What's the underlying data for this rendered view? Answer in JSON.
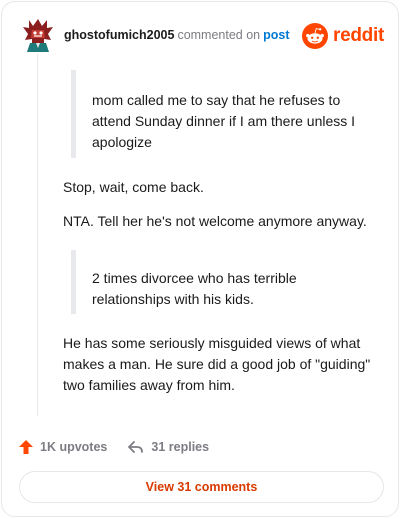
{
  "header": {
    "username": "ghostofumich2005",
    "action_text": "commented on",
    "post_link": "post",
    "brand_name": "reddit"
  },
  "comment": {
    "quote1": "mom called me to say that he refuses to attend Sunday dinner if I am there unless I apologize",
    "para1": "Stop, wait, come back.",
    "para2": "NTA. Tell her he's not welcome anymore anyway.",
    "quote2": "2 times divorcee who has terrible relationships with his kids.",
    "para3": "He has some seriously misguided views of what makes a man. He sure did a good job of \"guiding\" two families away from him."
  },
  "actions": {
    "upvotes": "1K upvotes",
    "replies": "31 replies"
  },
  "footer": {
    "view_comments": "View 31 comments"
  },
  "colors": {
    "brand": "#ff4500",
    "link": "#0079d3",
    "upvote": "#ff4500",
    "view_button_text": "#d93a00"
  }
}
